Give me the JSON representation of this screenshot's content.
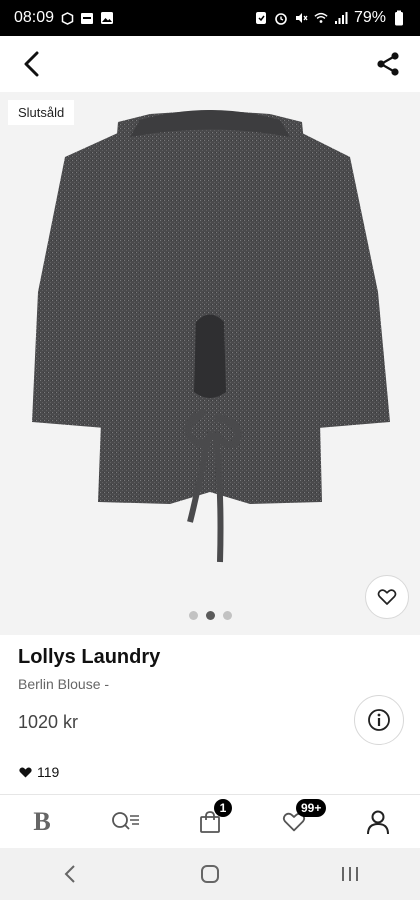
{
  "status_bar": {
    "time": "08:09",
    "battery": "79%",
    "left_icons": [
      "notification-icon",
      "calendar-icon",
      "gallery-icon"
    ],
    "right_icons": [
      "alarm-icon",
      "mute-icon",
      "wifi-icon",
      "signal-icon",
      "battery-icon"
    ]
  },
  "top_bar": {
    "back_icon": "chevron-left-icon",
    "share_icon": "share-icon"
  },
  "product_image": {
    "badge": "Slutsåld",
    "carousel": {
      "count": 3,
      "active_index": 1
    }
  },
  "product": {
    "brand": "Lollys Laundry",
    "name": "Berlin Blouse -",
    "price": "1020 kr",
    "likes": "119"
  },
  "bottom_nav": {
    "home_logo": "B",
    "cart_badge": "1",
    "favorites_badge": "99+",
    "items": [
      "home-logo",
      "search-list-icon",
      "shopping-bag-icon",
      "heart-icon",
      "profile-icon"
    ]
  },
  "colors": {
    "image_background": "#f3f3f3",
    "garment": "#4a4a4c",
    "badge_background": "#000000",
    "system_nav_background": "#f1f1f1"
  }
}
